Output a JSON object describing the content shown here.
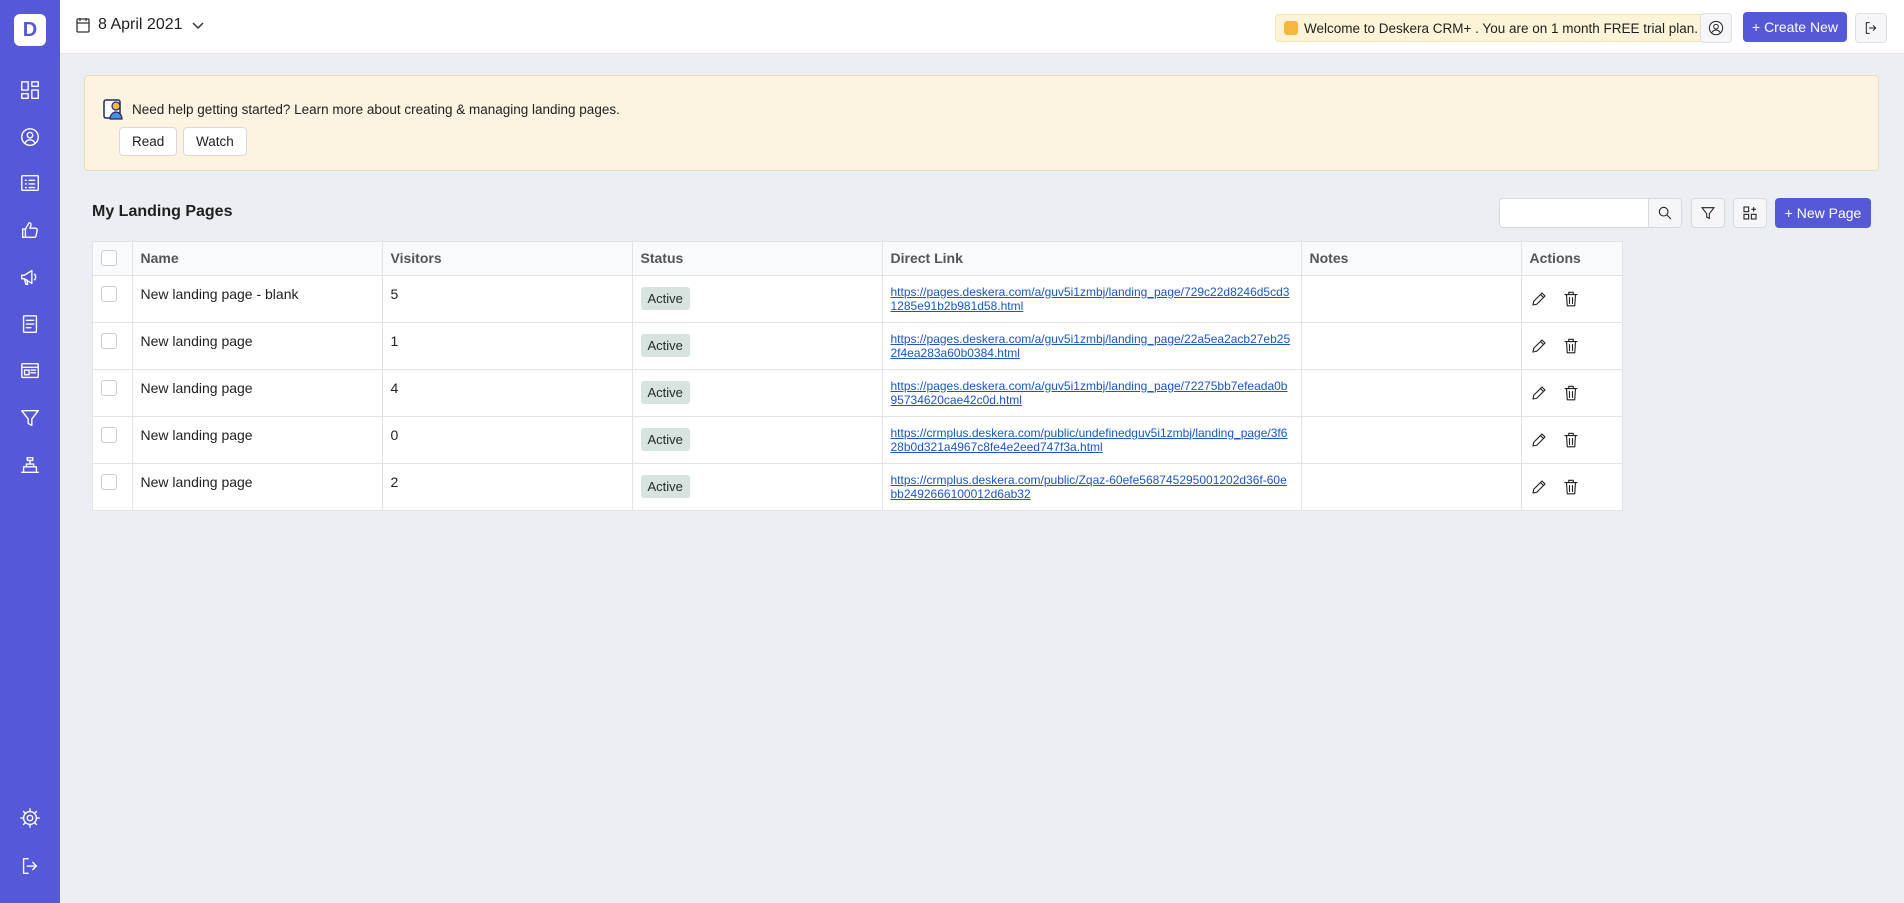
{
  "app": {
    "logo_letter": "D",
    "brand_color": "#5559d8"
  },
  "sidebar": {
    "top_items": [
      {
        "icon": "dashboard-icon"
      },
      {
        "icon": "contacts-icon"
      },
      {
        "icon": "list-icon"
      },
      {
        "icon": "thumbs-up-icon"
      },
      {
        "icon": "megaphone-icon"
      },
      {
        "icon": "document-icon"
      },
      {
        "icon": "landing-page-icon"
      },
      {
        "icon": "funnel-icon"
      },
      {
        "icon": "support-desk-icon"
      }
    ],
    "bottom_items": [
      {
        "icon": "gear-icon"
      },
      {
        "icon": "logout-icon"
      }
    ]
  },
  "header": {
    "date": "8 April 2021",
    "trial_message": "Welcome to Deskera CRM+ . You are on 1 month FREE trial plan.",
    "create_new_label": "+ Create New"
  },
  "help": {
    "text": "Need help getting started? Learn more about creating & managing landing pages.",
    "read_label": "Read",
    "watch_label": "Watch"
  },
  "page": {
    "title": "My Landing Pages",
    "search_placeholder": "",
    "new_page_label": "+ New Page"
  },
  "table": {
    "columns": [
      "Name",
      "Visitors",
      "Status",
      "Direct Link",
      "Notes",
      "Actions"
    ],
    "rows": [
      {
        "name": "New landing page - blank",
        "visitors": "5",
        "status": "Active",
        "link": "https://pages.deskera.com/a/guv5i1zmbj/landing_page/729c22d8246d5cd31285e91b2b981d58.html",
        "notes": ""
      },
      {
        "name": "New landing page",
        "visitors": "1",
        "status": "Active",
        "link": "https://pages.deskera.com/a/guv5i1zmbj/landing_page/22a5ea2acb27eb252f4ea283a60b0384.html",
        "notes": ""
      },
      {
        "name": "New landing page",
        "visitors": "4",
        "status": "Active",
        "link": "https://pages.deskera.com/a/guv5i1zmbj/landing_page/72275bb7efeada0b95734620cae42c0d.html",
        "notes": ""
      },
      {
        "name": "New landing page",
        "visitors": "0",
        "status": "Active",
        "link": "https://crmplus.deskera.com/public/undefinedguv5i1zmbj/landing_page/3f628b0d321a4967c8fe4e2eed747f3a.html",
        "notes": ""
      },
      {
        "name": "New landing page",
        "visitors": "2",
        "status": "Active",
        "link": "https://crmplus.deskera.com/public/Zqaz-60efe568745295001202d36f-60ebb2492666100012d6ab32",
        "notes": ""
      }
    ]
  }
}
